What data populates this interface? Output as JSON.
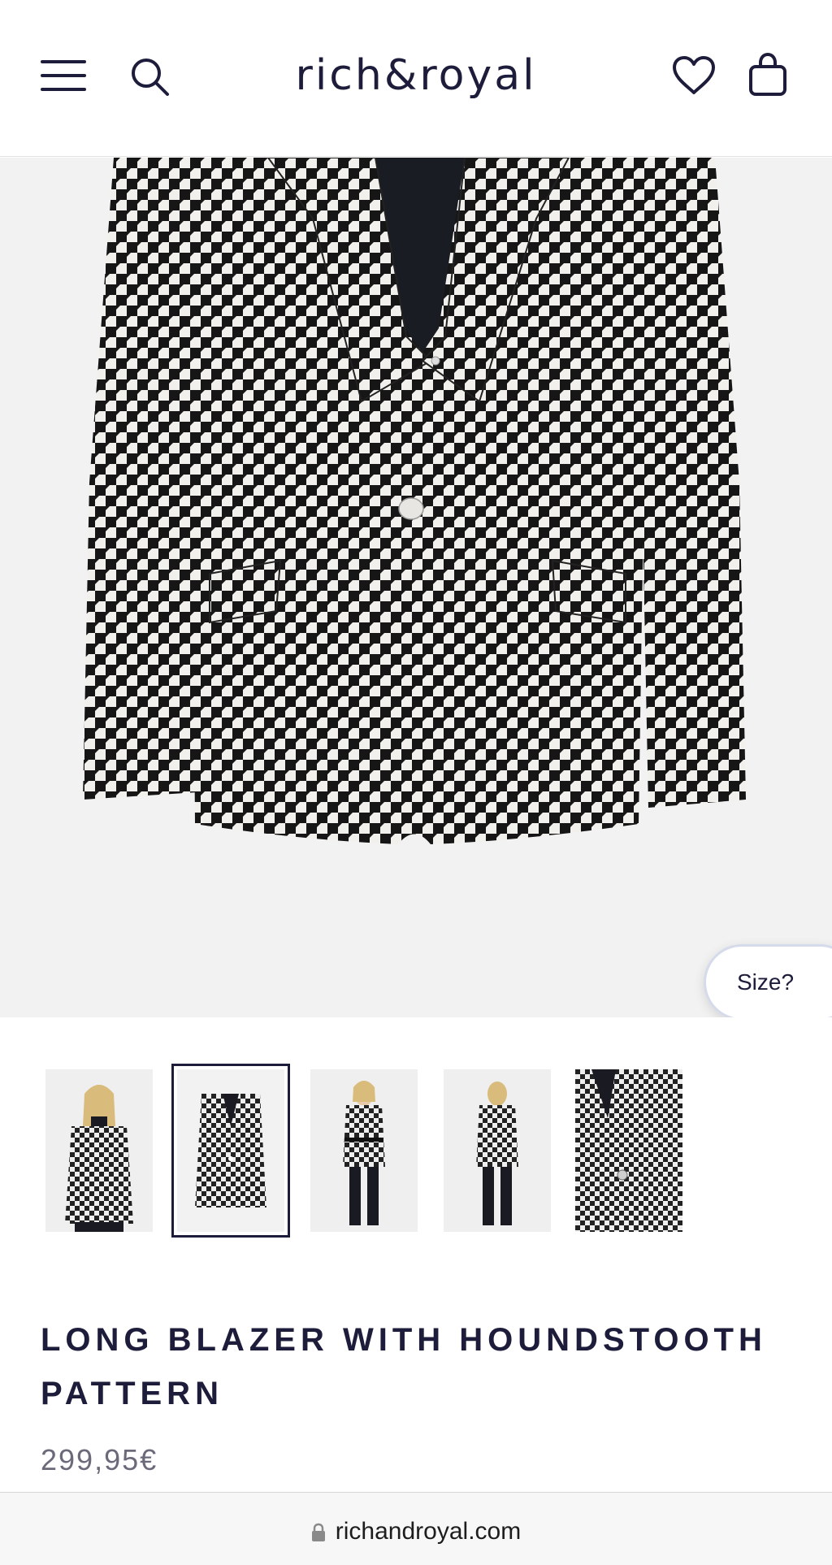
{
  "header": {
    "logo_text": "rich&royal",
    "icons": [
      "menu-icon",
      "search-icon",
      "heart-icon",
      "shopping-bag-icon"
    ]
  },
  "hero": {
    "size_button_label": "Size?",
    "background_color": "#f2f2f2"
  },
  "thumbnails": {
    "count": 5,
    "selected_index": 1
  },
  "product": {
    "title": "LONG BLAZER WITH HOUNDSTOOTH PATTERN",
    "price": "299,95€"
  },
  "browser": {
    "url": "richandroyal.com",
    "lock_icon": "lock-icon"
  },
  "colors": {
    "brand_navy": "#1d1d3b",
    "price_gray": "#6a6a7a"
  }
}
